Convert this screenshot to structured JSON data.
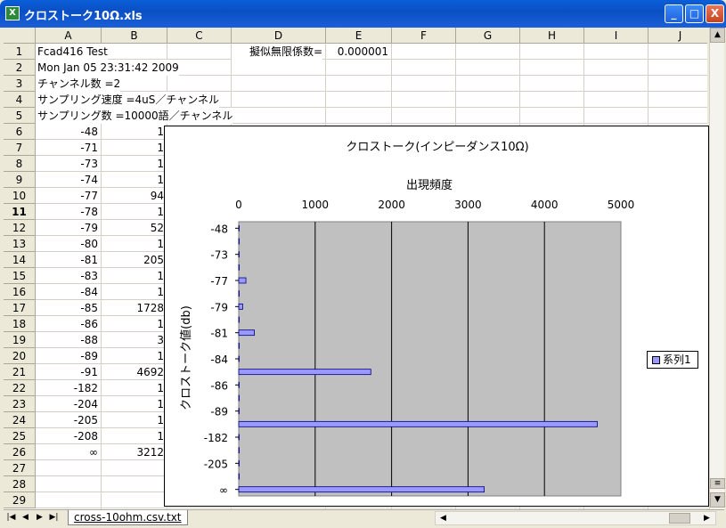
{
  "window": {
    "title": "クロストーク10Ω.xls",
    "buttons": [
      "_",
      "□",
      "X"
    ]
  },
  "columns": [
    "A",
    "B",
    "C",
    "D",
    "E",
    "F",
    "G",
    "H",
    "I",
    "J"
  ],
  "rows": [
    "1",
    "2",
    "3",
    "4",
    "5",
    "6",
    "7",
    "8",
    "9",
    "10",
    "11",
    "12",
    "13",
    "14",
    "15",
    "16",
    "17",
    "18",
    "19",
    "20",
    "21",
    "22",
    "23",
    "24",
    "25",
    "26",
    "27",
    "28",
    "29"
  ],
  "selected_row": "11",
  "cells": {
    "a1": "Fcad416 Test",
    "a2": "Mon Jan 05 23:31:42 2009",
    "a3": "チャンネル数 =2",
    "a4": "サンプリング速度 =4uS／チャンネル",
    "a5": "サンプリング数 =10000語／チャンネル",
    "d1": "擬似無限係数=",
    "e1": "0.000001"
  },
  "data_rows": [
    {
      "a": "-48",
      "b": "1"
    },
    {
      "a": "-71",
      "b": "1"
    },
    {
      "a": "-73",
      "b": "1"
    },
    {
      "a": "-74",
      "b": "1"
    },
    {
      "a": "-77",
      "b": "94"
    },
    {
      "a": "-78",
      "b": "1"
    },
    {
      "a": "-79",
      "b": "52"
    },
    {
      "a": "-80",
      "b": "1"
    },
    {
      "a": "-81",
      "b": "205"
    },
    {
      "a": "-83",
      "b": "1"
    },
    {
      "a": "-84",
      "b": "1"
    },
    {
      "a": "-85",
      "b": "1728"
    },
    {
      "a": "-86",
      "b": "1"
    },
    {
      "a": "-88",
      "b": "3"
    },
    {
      "a": "-89",
      "b": "1"
    },
    {
      "a": "-91",
      "b": "4692"
    },
    {
      "a": "-182",
      "b": "1"
    },
    {
      "a": "-204",
      "b": "1"
    },
    {
      "a": "-205",
      "b": "1"
    },
    {
      "a": "-208",
      "b": "1"
    },
    {
      "a": "∞",
      "b": "3212"
    }
  ],
  "sheet_tab": "cross-10ohm.csv.txt",
  "colors": {
    "plot_bg": "#c0c0c0",
    "bar_fill": "#9999ff",
    "bar_stroke": "#000080"
  },
  "chart_data": {
    "type": "bar",
    "orientation": "horizontal",
    "title": "クロストーク(インピーダンス10Ω)",
    "xlabel": "出現頻度",
    "ylabel": "クロストーク値(db)",
    "xlim": [
      0,
      5000
    ],
    "x_ticks": [
      "0",
      "1000",
      "2000",
      "3000",
      "4000",
      "5000"
    ],
    "y_tick_labels": [
      "-48",
      "-73",
      "-77",
      "-79",
      "-81",
      "-84",
      "-86",
      "-89",
      "-182",
      "-205",
      "∞"
    ],
    "categories": [
      "-48",
      "-71",
      "-73",
      "-74",
      "-77",
      "-78",
      "-79",
      "-80",
      "-81",
      "-83",
      "-84",
      "-85",
      "-86",
      "-88",
      "-89",
      "-91",
      "-182",
      "-204",
      "-205",
      "-208",
      "∞"
    ],
    "series": [
      {
        "name": "系列1",
        "values": [
          1,
          1,
          1,
          1,
          94,
          1,
          52,
          1,
          205,
          1,
          1,
          1728,
          1,
          3,
          1,
          4692,
          1,
          1,
          1,
          1,
          3212
        ]
      }
    ],
    "legend": "right",
    "grid": true
  }
}
